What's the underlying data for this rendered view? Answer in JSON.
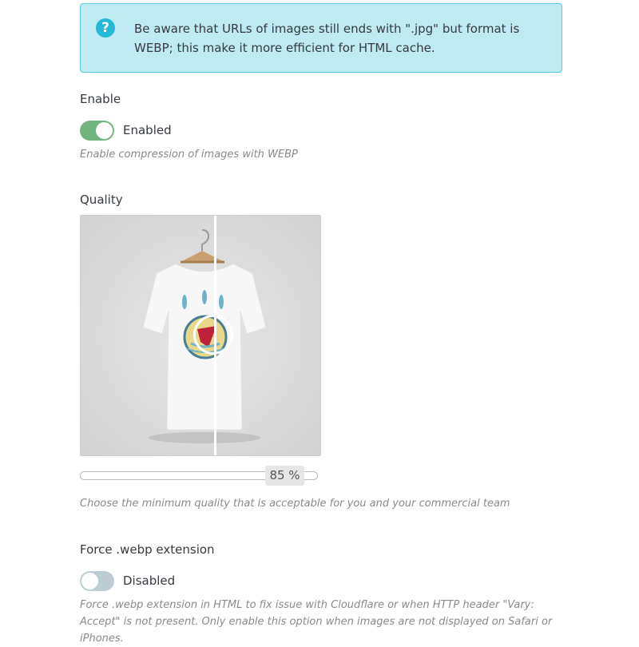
{
  "alert": {
    "icon": "question-circle-icon",
    "text": "Be aware that URLs of images still ends with \".jpg\" but format is WEBP; this make it more efficient for HTML cache."
  },
  "enable": {
    "label": "Enable",
    "state_label": "Enabled",
    "on": true,
    "help": "Enable compression of images with WEBP"
  },
  "quality": {
    "label": "Quality",
    "preview_image": "t-shirt with bird print on hanger, before/after comparison",
    "value": 85,
    "value_label": "85 %",
    "help": "Choose the minimum quality that is acceptable for you and your commercial team"
  },
  "force_webp": {
    "label": "Force .webp extension",
    "state_label": "Disabled",
    "on": false,
    "help": "Force .webp extension in HTML to fix issue with Cloudflare or when HTTP header \"Vary: Accept\" is not present. Only enable this option when images are not displayed on Safari or iPhones."
  },
  "colors": {
    "alert_bg": "#bdeaf3",
    "alert_border": "#5ac8de",
    "info_icon": "#25b9d7",
    "switch_on": "#70b580",
    "switch_off": "#bbcdd2"
  }
}
